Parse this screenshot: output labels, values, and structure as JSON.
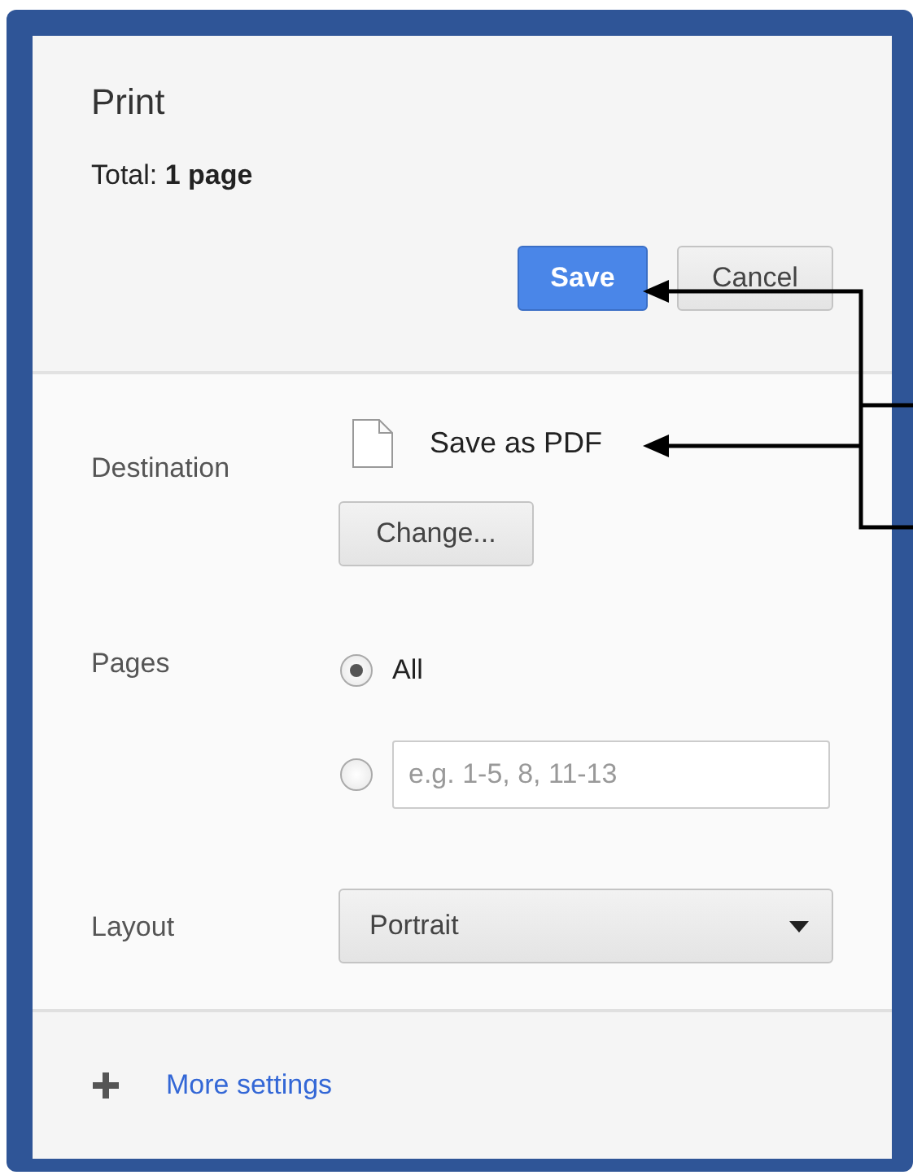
{
  "dialog": {
    "title": "Print",
    "total": "Total: **1 page**",
    "buttons": [
      {
        "label": "Save",
        "kind": "primary"
      },
      {
        "label": "Cancel",
        "kind": "secondary"
      }
    ],
    "destination": {
      "label": "Destination",
      "name": "Save as PDF",
      "button": "Change..."
    },
    "pages": {
      "label": "Pages",
      "options": [
        {
          "kind": "all",
          "label": "All",
          "selected": true
        },
        {
          "kind": "range",
          "placeholder": "e.g. 1-5, 8, 11-13",
          "selected": false
        }
      ]
    },
    "layout": {
      "label": "Layout",
      "value": "Portrait"
    },
    "more_settings": "More settings"
  }
}
